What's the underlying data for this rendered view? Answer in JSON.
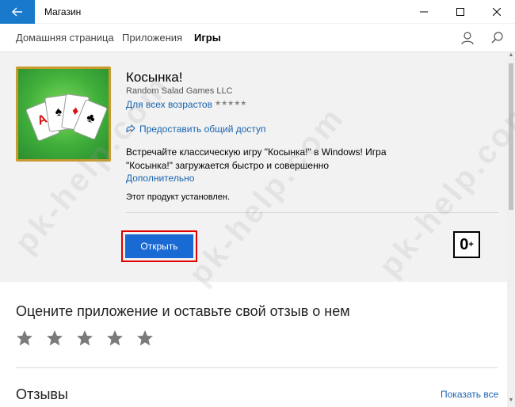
{
  "window": {
    "title": "Магазин",
    "back_icon": "arrow-left",
    "controls": [
      "minimize",
      "maximize",
      "close"
    ]
  },
  "nav": {
    "items": [
      {
        "label": "Домашняя страница",
        "active": false
      },
      {
        "label": "Приложения",
        "active": false
      },
      {
        "label": "Игры",
        "active": true
      }
    ],
    "user_icon": "user-icon",
    "search_icon": "search-icon"
  },
  "product": {
    "name": "Косынка!",
    "publisher": "Random Salad Games LLC",
    "age_rating_text": "Для всех возрастов",
    "stars": "★★★★★",
    "share_label": "Предоставить общий доступ",
    "description": "Встречайте классическую игру \"Косынка!\" в Windows! Игра \"Косынка!\" загружается быстро и совершенно",
    "more_label": "Дополнительно",
    "installed_text": "Этот продукт установлен.",
    "open_label": "Открыть",
    "age_badge": "0",
    "age_badge_suffix": "+",
    "cards": [
      "A",
      "♠",
      "♦",
      "♣"
    ]
  },
  "rating_section": {
    "title": "Оцените приложение и оставьте свой отзыв о нем",
    "star_count": 5
  },
  "reviews": {
    "title": "Отзывы",
    "show_all": "Показать все"
  },
  "watermark": "pk-help.com",
  "colors": {
    "accent": "#1979ca",
    "button": "#1a6ad3",
    "link": "#1a64b0",
    "highlight": "#e00000",
    "panel_bg": "#f2f2f2"
  }
}
